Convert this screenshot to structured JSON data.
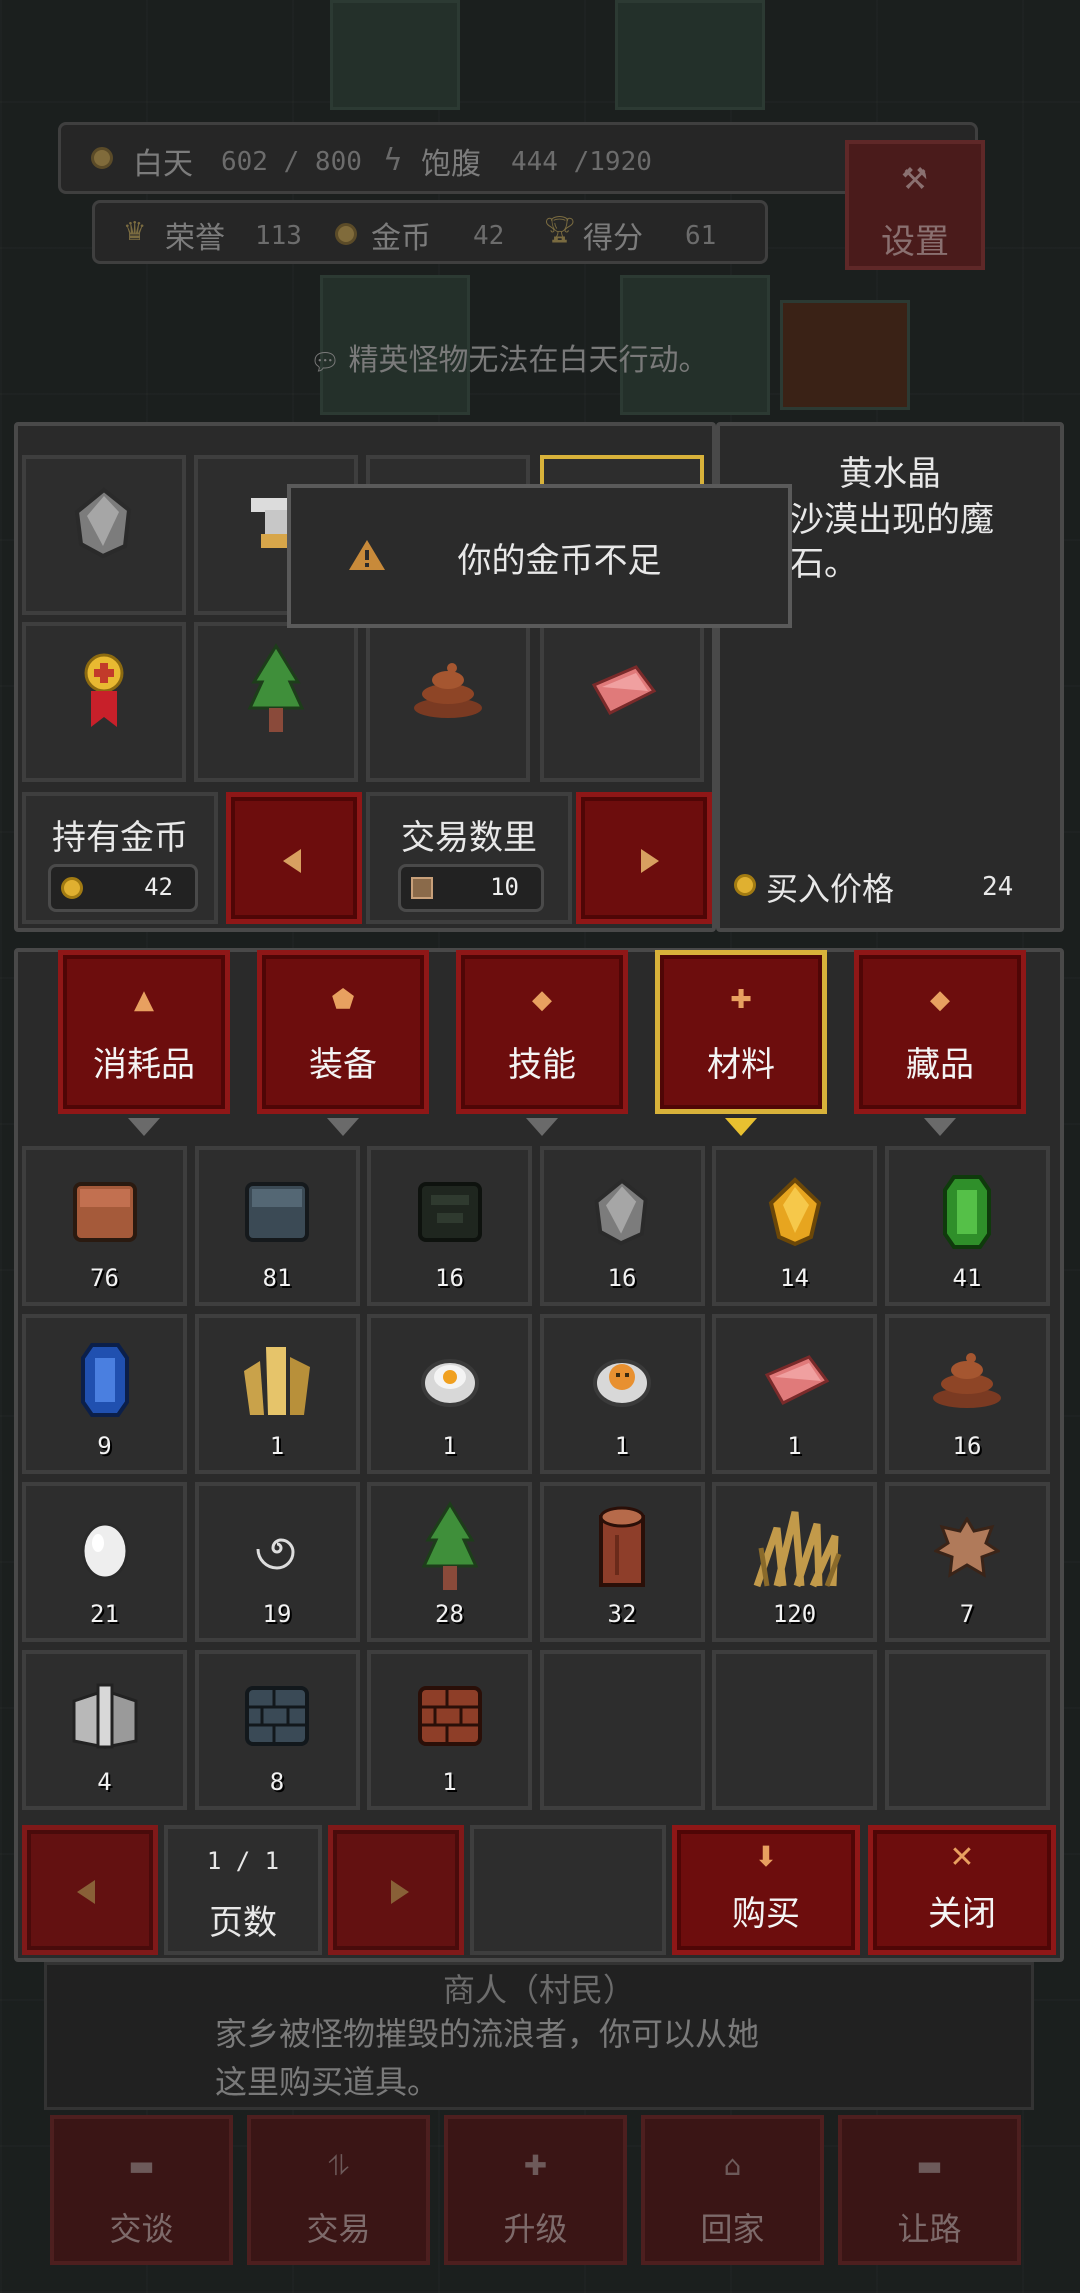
{
  "hud": {
    "daytime_label": "白天",
    "daytime_value": "602 / 800",
    "satiety_label": "饱腹",
    "satiety_value": "444 /1920",
    "honor_label": "荣誉",
    "honor_value": "113",
    "gold_label": "金币",
    "gold_value": "42",
    "score_label": "得分",
    "score_value": "61",
    "settings_label": "设置",
    "notice": "精英怪物无法在白天行动。"
  },
  "tooltip": {
    "message": "你的金币不足"
  },
  "detail": {
    "item_name": "黄水晶",
    "description": "沙漠出现的魔石。",
    "price_label": "买入价格",
    "price_value": "24"
  },
  "trade": {
    "held_gold_label": "持有金币",
    "held_gold_value": "42",
    "trade_qty_label": "交易数里",
    "trade_qty_value": "10"
  },
  "categories": [
    {
      "label": "消耗品",
      "selected": false
    },
    {
      "label": "装备",
      "selected": false
    },
    {
      "label": "技能",
      "selected": false
    },
    {
      "label": "材料",
      "selected": true
    },
    {
      "label": "藏品",
      "selected": false
    }
  ],
  "shop_items": [
    "stone-icon",
    "crafting-icon",
    "",
    "",
    "medal-icon",
    "tree-icon",
    "dung-icon",
    "meat-icon"
  ],
  "inventory": [
    {
      "icon": "clay-block-icon",
      "qty": "76"
    },
    {
      "icon": "iron-block-icon",
      "qty": "81"
    },
    {
      "icon": "dark-block-icon",
      "qty": "16"
    },
    {
      "icon": "stone-icon",
      "qty": "16"
    },
    {
      "icon": "citrine-icon",
      "qty": "14"
    },
    {
      "icon": "emerald-icon",
      "qty": "41"
    },
    {
      "icon": "sapphire-icon",
      "qty": "9"
    },
    {
      "icon": "gold-crystal-icon",
      "qty": "1"
    },
    {
      "icon": "egg-dish-icon",
      "qty": "1"
    },
    {
      "icon": "orange-dish-icon",
      "qty": "1"
    },
    {
      "icon": "meat-icon",
      "qty": "1"
    },
    {
      "icon": "dung-icon",
      "qty": "16"
    },
    {
      "icon": "egg-icon",
      "qty": "21"
    },
    {
      "icon": "spiral-icon",
      "qty": "19"
    },
    {
      "icon": "tree-icon",
      "qty": "28"
    },
    {
      "icon": "log-icon",
      "qty": "32"
    },
    {
      "icon": "grass-icon",
      "qty": "120"
    },
    {
      "icon": "hide-icon",
      "qty": "7"
    },
    {
      "icon": "book-icon",
      "qty": "4"
    },
    {
      "icon": "brick-blue-icon",
      "qty": "8"
    },
    {
      "icon": "brick-red-icon",
      "qty": "1"
    },
    {
      "icon": "",
      "qty": ""
    },
    {
      "icon": "",
      "qty": ""
    },
    {
      "icon": "",
      "qty": ""
    }
  ],
  "pager": {
    "page_text": "1 / 1",
    "page_label": "页数"
  },
  "actions": {
    "buy_label": "购买",
    "close_label": "关闭"
  },
  "npc": {
    "name": "商人（村民）",
    "line1": "家乡被怪物摧毁的流浪者，你可以从她",
    "line2": "这里购买道具。"
  },
  "bottom_menu": [
    "交谈",
    "交易",
    "升级",
    "回家",
    "让路"
  ],
  "colors": {
    "button_red": "#6d0d0d",
    "selected_gold": "#d8b23a",
    "panel_bg": "#2a2a2a"
  }
}
